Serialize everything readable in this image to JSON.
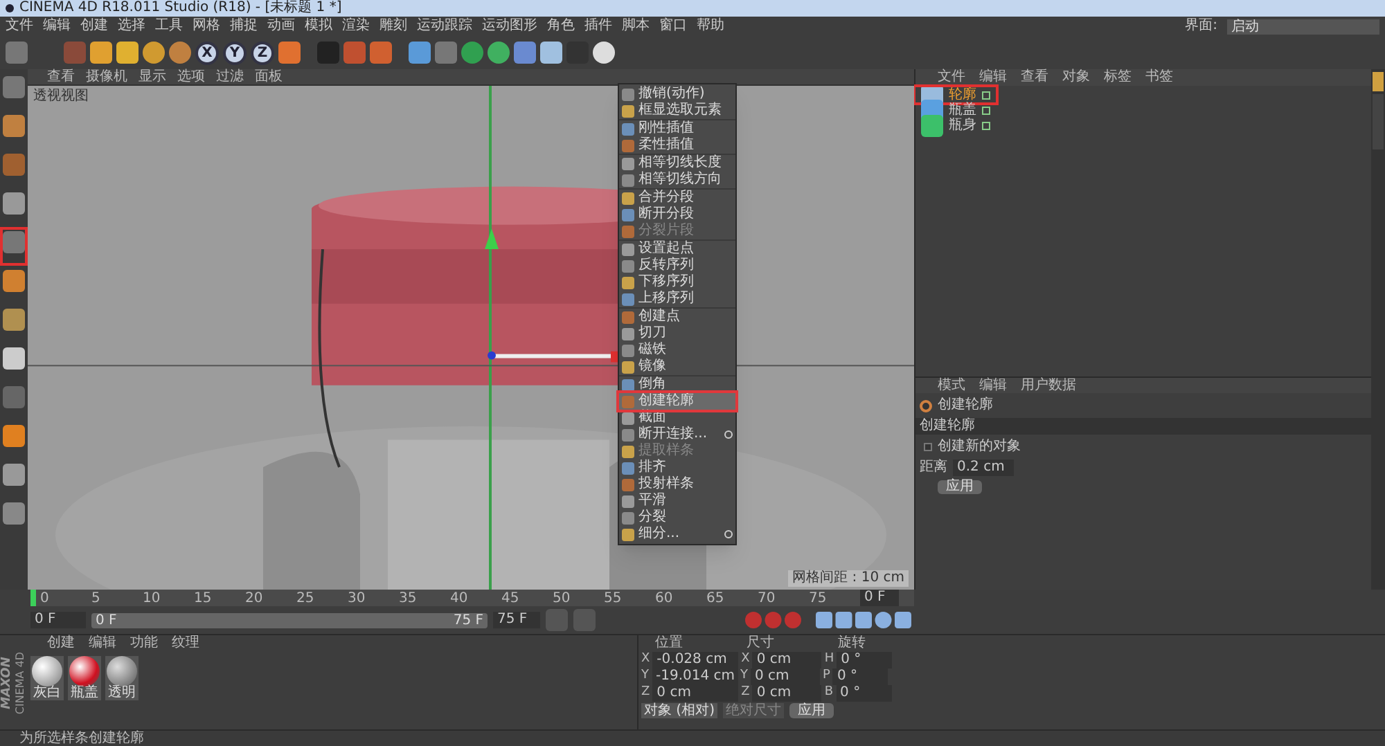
{
  "window": {
    "title": "CINEMA 4D R18.011 Studio (R18) - [未标题 1 *]"
  },
  "menu_bar": [
    "文件",
    "编辑",
    "创建",
    "选择",
    "工具",
    "网格",
    "捕捉",
    "动画",
    "模拟",
    "渲染",
    "雕刻",
    "运动跟踪",
    "运动图形",
    "角色",
    "插件",
    "脚本",
    "窗口",
    "帮助"
  ],
  "layout_selector": {
    "label": "界面:",
    "value": "启动"
  },
  "toolbar": {
    "axis_buttons": [
      {
        "label": "X",
        "selected": true
      },
      {
        "label": "Y",
        "selected": true
      },
      {
        "label": "Z",
        "selected": true
      }
    ]
  },
  "viewport": {
    "menu": [
      "查看",
      "摄像机",
      "显示",
      "选项",
      "过滤",
      "面板"
    ],
    "label": "透视视图",
    "grid_spacing": "网格间距 : 10 cm"
  },
  "context_menu": [
    {
      "items": [
        {
          "label": "撤销(动作)",
          "disabled": false,
          "selected": false,
          "options": false
        },
        {
          "label": "框显选取元素",
          "disabled": false,
          "selected": false,
          "options": false
        }
      ]
    },
    {
      "items": [
        {
          "label": "刚性插值",
          "disabled": false,
          "selected": false,
          "options": false
        },
        {
          "label": "柔性插值",
          "disabled": false,
          "selected": false,
          "options": false
        }
      ]
    },
    {
      "items": [
        {
          "label": "相等切线长度",
          "disabled": false,
          "selected": false,
          "options": false
        },
        {
          "label": "相等切线方向",
          "disabled": false,
          "selected": false,
          "options": false
        }
      ]
    },
    {
      "items": [
        {
          "label": "合并分段",
          "disabled": false,
          "selected": false,
          "options": false
        },
        {
          "label": "断开分段",
          "disabled": false,
          "selected": false,
          "options": false
        },
        {
          "label": "分裂片段",
          "disabled": true,
          "selected": false,
          "options": false
        }
      ]
    },
    {
      "items": [
        {
          "label": "设置起点",
          "disabled": false,
          "selected": false,
          "options": false
        },
        {
          "label": "反转序列",
          "disabled": false,
          "selected": false,
          "options": false
        },
        {
          "label": "下移序列",
          "disabled": false,
          "selected": false,
          "options": false
        },
        {
          "label": "上移序列",
          "disabled": false,
          "selected": false,
          "options": false
        }
      ]
    },
    {
      "items": [
        {
          "label": "创建点",
          "disabled": false,
          "selected": false,
          "options": false
        },
        {
          "label": "切刀",
          "disabled": false,
          "selected": false,
          "options": false
        },
        {
          "label": "磁铁",
          "disabled": false,
          "selected": false,
          "options": false
        },
        {
          "label": "镜像",
          "disabled": false,
          "selected": false,
          "options": false
        }
      ]
    },
    {
      "items": [
        {
          "label": "倒角",
          "disabled": false,
          "selected": false,
          "options": false
        },
        {
          "label": "创建轮廓",
          "disabled": false,
          "selected": true,
          "options": false
        },
        {
          "label": "截面",
          "disabled": false,
          "selected": false,
          "options": false
        },
        {
          "label": "断开连接...",
          "disabled": false,
          "selected": false,
          "options": true
        },
        {
          "label": "提取样条",
          "disabled": true,
          "selected": false,
          "options": false
        },
        {
          "label": "排齐",
          "disabled": false,
          "selected": false,
          "options": false
        },
        {
          "label": "投射样条",
          "disabled": false,
          "selected": false,
          "options": false
        },
        {
          "label": "平滑",
          "disabled": false,
          "selected": false,
          "options": false
        },
        {
          "label": "分裂",
          "disabled": false,
          "selected": false,
          "options": false
        },
        {
          "label": "细分...",
          "disabled": false,
          "selected": false,
          "options": true
        }
      ]
    }
  ],
  "object_manager": {
    "tabs": [
      "文件",
      "编辑",
      "查看",
      "对象",
      "标签",
      "书签"
    ],
    "objects": [
      {
        "name": "轮廓",
        "kind": "spline",
        "selected": true
      },
      {
        "name": "瓶盖",
        "kind": "cap",
        "selected": false
      },
      {
        "name": "瓶身",
        "kind": "bottle",
        "selected": false
      }
    ]
  },
  "attribute_manager": {
    "tabs": [
      "模式",
      "编辑",
      "用户数据"
    ],
    "title": "创建轮廓",
    "section": "创建轮廓",
    "checkbox": {
      "label": "创建新的对象",
      "checked": false
    },
    "field": {
      "label": "距离",
      "value": "0.2 cm"
    },
    "apply": "应用"
  },
  "timeline": {
    "ticks": [
      "0",
      "5",
      "10",
      "15",
      "20",
      "25",
      "30",
      "35",
      "40",
      "45",
      "50",
      "55",
      "60",
      "65",
      "70",
      "75"
    ],
    "end_readout": "0 F",
    "start_field": "0 F",
    "range_start": "0 F",
    "range_end": "75 F",
    "end_field": "75 F"
  },
  "brand": [
    "MAXON",
    "CINEMA 4D"
  ],
  "material_manager": {
    "tabs": [
      "创建",
      "编辑",
      "功能",
      "纹理"
    ],
    "materials": [
      {
        "name": "灰白",
        "kind": "chrome"
      },
      {
        "name": "瓶盖",
        "kind": "red"
      },
      {
        "name": "透明",
        "kind": "glass"
      }
    ]
  },
  "coordinates": {
    "headers": [
      "位置",
      "尺寸",
      "旋转"
    ],
    "rows": [
      {
        "axis": "X",
        "position": "-0.028 cm",
        "size_axis": "X",
        "size": "0 cm",
        "rot_axis": "H",
        "rotation": "0 °"
      },
      {
        "axis": "Y",
        "position": "-19.014 cm",
        "size_axis": "Y",
        "size": "0 cm",
        "rot_axis": "P",
        "rotation": "0 °"
      },
      {
        "axis": "Z",
        "position": "0 cm",
        "size_axis": "Z",
        "size": "0 cm",
        "rot_axis": "B",
        "rotation": "0 °"
      }
    ],
    "mode": "对象 (相对)",
    "size_mode": "绝对尺寸",
    "apply": "应用"
  },
  "status_bar": "为所选样条创建轮廓"
}
